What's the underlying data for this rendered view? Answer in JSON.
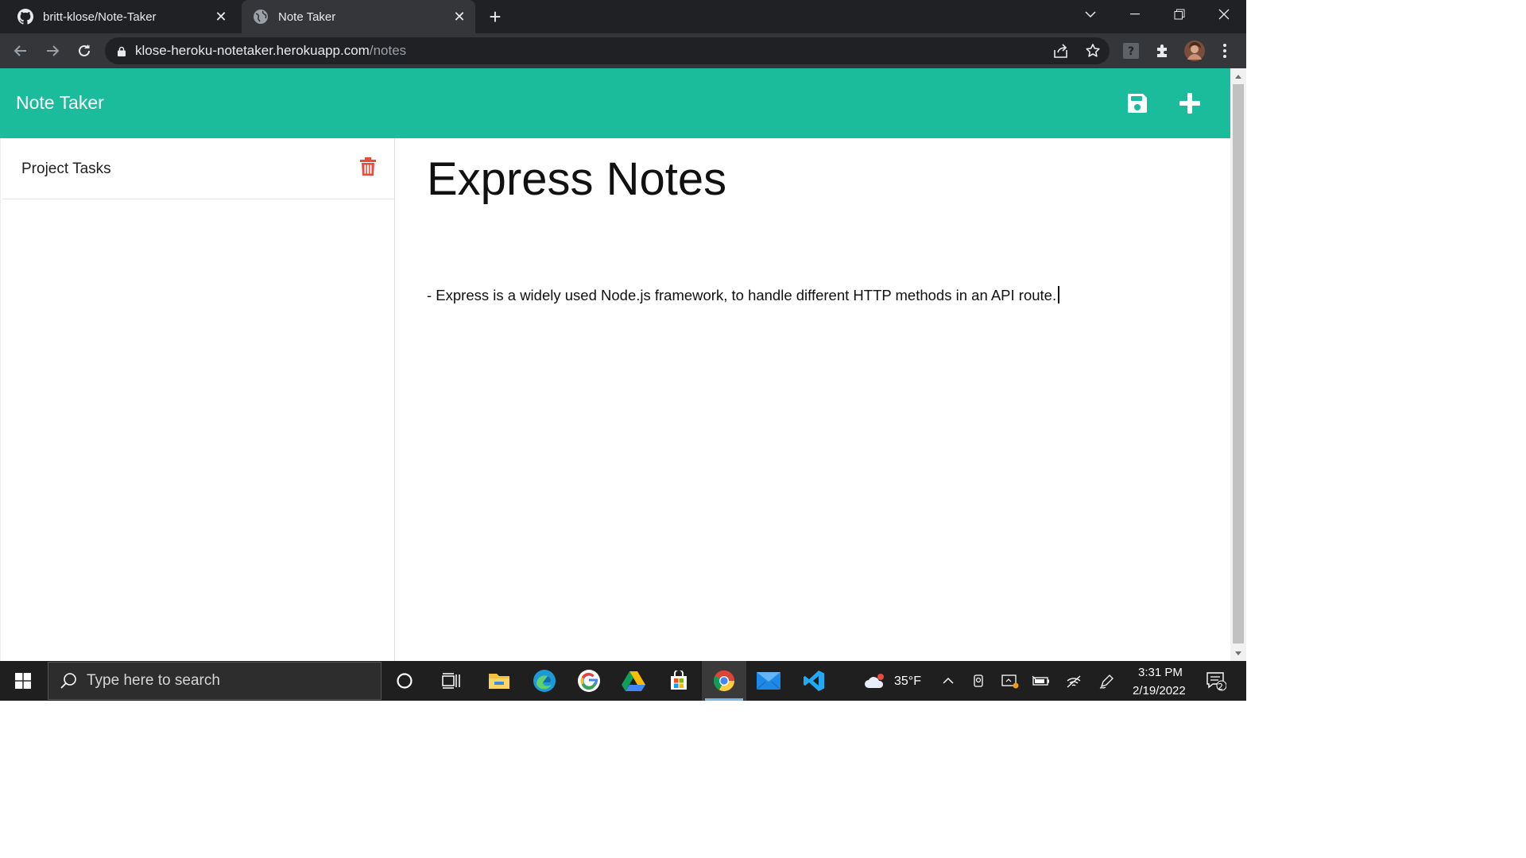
{
  "browser": {
    "tabs": [
      {
        "title": "britt-klose/Note-Taker",
        "icon": "github-icon"
      },
      {
        "title": "Note Taker",
        "icon": "globe-icon"
      }
    ],
    "url_host": "klose-heroku-notetaker.herokuapp.com",
    "url_path": "/notes"
  },
  "app": {
    "brand": "Note Taker",
    "accent": "#1abc9c",
    "notes": [
      {
        "title": "Project Tasks"
      }
    ],
    "active_note": {
      "title": "Express Notes",
      "text": "- Express is a widely used Node.js framework, to handle different HTTP methods in an API route."
    }
  },
  "taskbar": {
    "search_placeholder": "Type here to search",
    "weather": "35°F",
    "time": "3:31 PM",
    "date": "2/19/2022",
    "notification_count": "2"
  }
}
